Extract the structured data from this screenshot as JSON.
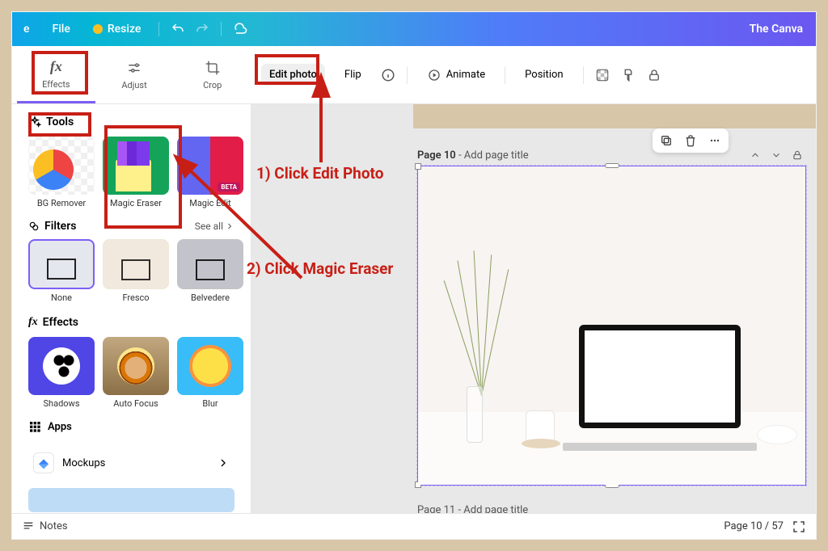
{
  "topbar": {
    "home": "e",
    "file": "File",
    "resize": "Resize",
    "title": "The Canva"
  },
  "side_tabs": {
    "effects": "Effects",
    "adjust": "Adjust",
    "crop": "Crop"
  },
  "toolbar": {
    "edit_photo": "Edit photo",
    "flip": "Flip",
    "animate": "Animate",
    "position": "Position"
  },
  "panel": {
    "tools_heading": "Tools",
    "tools": [
      {
        "label": "BG Remover"
      },
      {
        "label": "Magic Eraser"
      },
      {
        "label": "Magic Edit",
        "beta": "BETA"
      }
    ],
    "filters_heading": "Filters",
    "see_all": "See all",
    "filters": [
      {
        "label": "None"
      },
      {
        "label": "Fresco"
      },
      {
        "label": "Belvedere"
      }
    ],
    "effects_heading": "Effects",
    "effects": [
      {
        "label": "Shadows"
      },
      {
        "label": "Auto Focus"
      },
      {
        "label": "Blur"
      }
    ],
    "apps_heading": "Apps",
    "mockups": "Mockups"
  },
  "canvas": {
    "page10_prefix": "Page 10",
    "page10_suffix": " - Add page title",
    "page11_prefix": "Page 11",
    "page11_suffix": " - Add page title"
  },
  "bottom": {
    "notes": "Notes",
    "page_counter": "Page 10 / 57"
  },
  "annotations": {
    "step1": "1) Click Edit Photo",
    "step2": "2) Click Magic Eraser"
  }
}
